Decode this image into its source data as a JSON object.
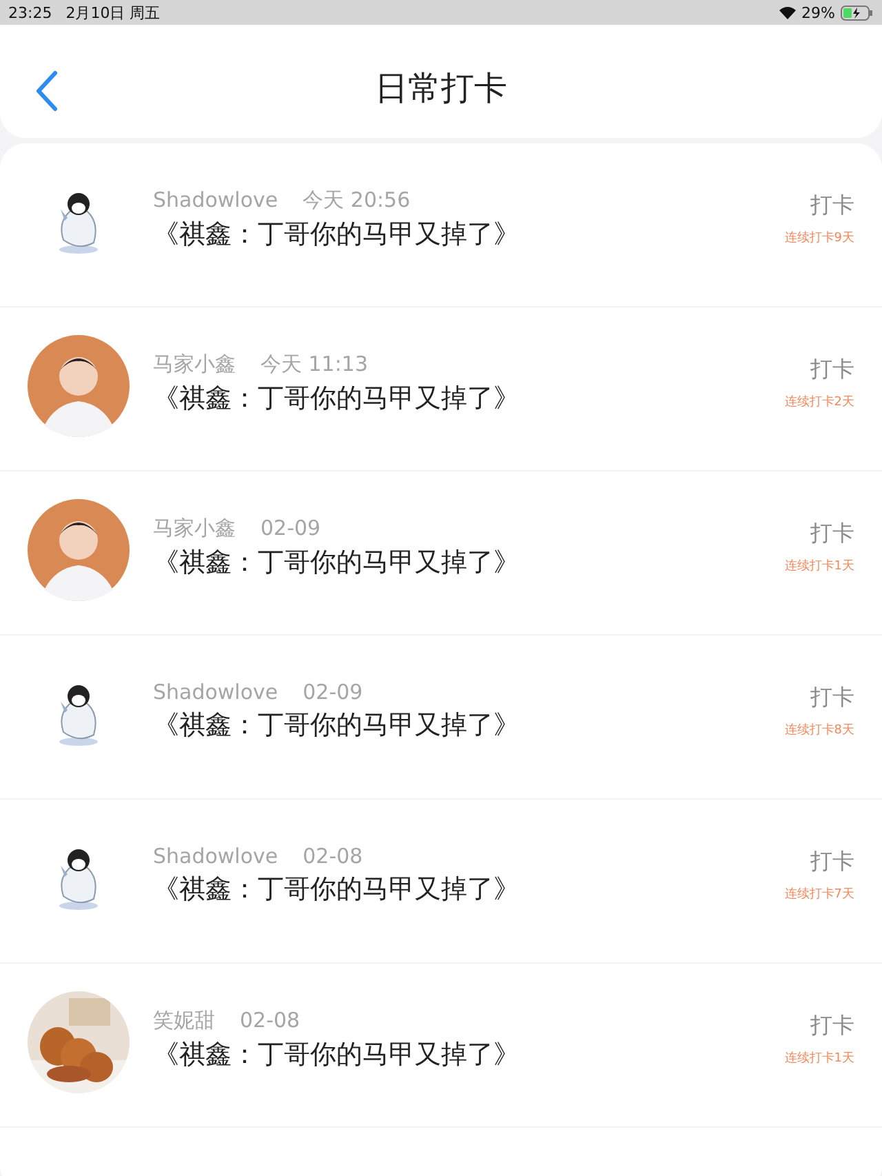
{
  "status_bar": {
    "time": "23:25",
    "date": "2月10日 周五",
    "battery": "29%"
  },
  "header": {
    "title": "日常打卡"
  },
  "entries": [
    {
      "avatar": {
        "kind": "penguin"
      },
      "user": "Shadowlove",
      "time": "今天 20:56",
      "title": "《祺鑫：丁哥你的马甲又掉了》",
      "action": "打卡",
      "streak": "连续打卡9天"
    },
    {
      "avatar": {
        "kind": "person"
      },
      "user": "马家小鑫",
      "time": "今天 11:13",
      "title": "《祺鑫：丁哥你的马甲又掉了》",
      "action": "打卡",
      "streak": "连续打卡2天"
    },
    {
      "avatar": {
        "kind": "person"
      },
      "user": "马家小鑫",
      "time": "02-09",
      "title": "《祺鑫：丁哥你的马甲又掉了》",
      "action": "打卡",
      "streak": "连续打卡1天"
    },
    {
      "avatar": {
        "kind": "penguin"
      },
      "user": "Shadowlove",
      "time": "02-09",
      "title": "《祺鑫：丁哥你的马甲又掉了》",
      "action": "打卡",
      "streak": "连续打卡8天"
    },
    {
      "avatar": {
        "kind": "penguin"
      },
      "user": "Shadowlove",
      "time": "02-08",
      "title": "《祺鑫：丁哥你的马甲又掉了》",
      "action": "打卡",
      "streak": "连续打卡7天"
    },
    {
      "user": "笑妮甜",
      "time": "02-08",
      "title": "《祺鑫：丁哥你的马甲又掉了》",
      "action": "打卡",
      "streak": "连续打卡1天"
    }
  ]
}
